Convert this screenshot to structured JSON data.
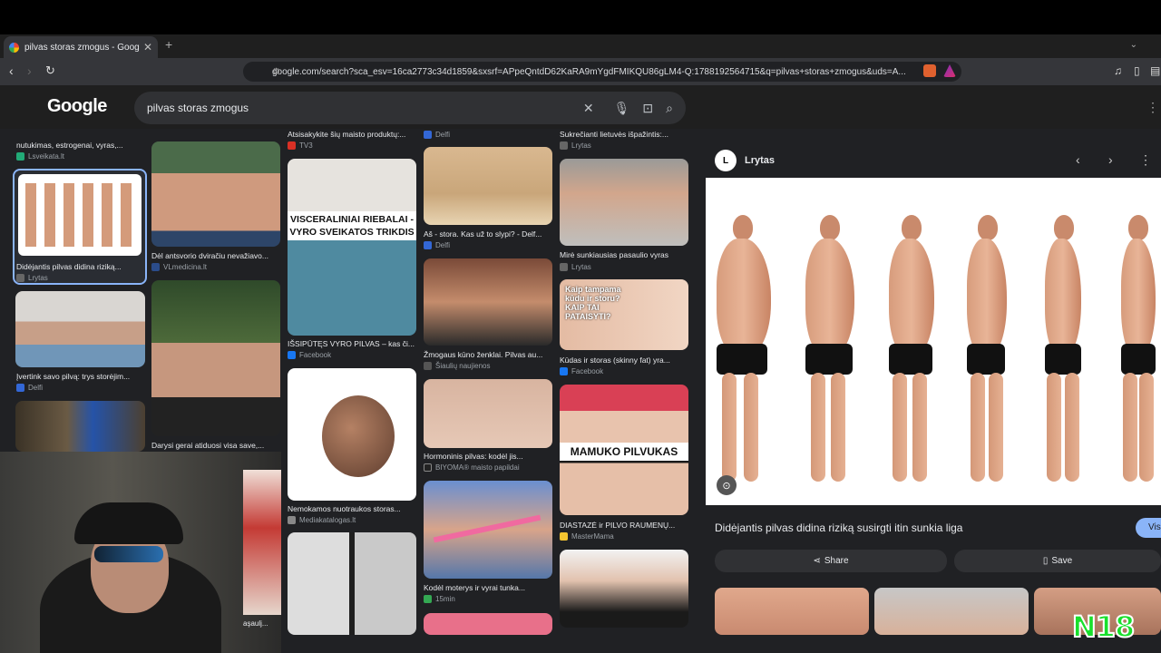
{
  "browser": {
    "tab_title": "pilvas storas zmogus - Google S",
    "url": "google.com/search?sca_esv=16ca2773c34d1859&sxsrf=APpeQntdD62KaRA9mYgdFMIKQU86gLM4-Q:1788192564715&q=pilvas+storas+zmogus&uds=A..."
  },
  "google": {
    "logo": "Google",
    "query": "pilvas storas zmogus"
  },
  "results": {
    "c1": [
      {
        "cap": "nutukimas, estrogenai, vyras,...",
        "src": "Lsveikata.lt"
      },
      {
        "cap": "Didėjantis pilvas didina riziką...",
        "src": "Lrytas"
      },
      {
        "cap": "Įvertink savo pilvą: trys storėjim...",
        "src": "Delfi"
      }
    ],
    "c2": [
      {
        "cap": "Dėl antsvorio dviračiu nevažiavo...",
        "src": "VLmedicina.lt"
      },
      {
        "cap": "Darysi gerai atiduosi visa save,...",
        "src": ""
      }
    ],
    "c3": [
      {
        "cap": "Atsisakykite šių maisto produktų:...",
        "src": "TV3"
      },
      {
        "cap": "IŠSIPŪTĘS VYRO PILVAS – kas či...",
        "src": "Facebook",
        "overlay": "VISCERALINIAI RIEBALAI - VYRO SVEIKATOS TRIKDIS"
      },
      {
        "cap": "Nemokamos nuotraukos storas...",
        "src": "Mediakatalogas.lt"
      }
    ],
    "c4": [
      {
        "cap": "",
        "src": "Delfi"
      },
      {
        "cap": "Aš - stora. Kas už to slypi? - Delf...",
        "src": "Delfi"
      },
      {
        "cap": "Žmogaus kūno ženklai. Pilvas au...",
        "src": "Šiaulių naujienos"
      },
      {
        "cap": "Hormoninis pilvas: kodėl jis...",
        "src": "BIYOMA® maisto papildai"
      },
      {
        "cap": "Kodėl moterys ir vyrai tunka...",
        "src": "15min"
      }
    ],
    "c5": [
      {
        "cap": "Sukrečianti lietuvės išpažintis:...",
        "src": "Lrytas"
      },
      {
        "cap": "Mirė sunkiausias pasaulio vyras",
        "src": "Lrytas"
      },
      {
        "cap": "Kūdas ir storas (skinny fat) yra...",
        "src": "Facebook",
        "overlay": "Kaip tampama kūdu ir storu? KAIP TAI PATAISYTI?"
      },
      {
        "cap": "DIASTAZĖ ir PILVO RAUMENŲ...",
        "src": "MasterMama",
        "overlay": "MAMUKO PILVUKAS"
      }
    ]
  },
  "panel": {
    "source": "Lrytas",
    "title": "Didėjantis pilvas didina riziką susirgti itin sunkia liga",
    "visit": "Vis",
    "share": "Share",
    "save": "Save"
  },
  "webcam": {
    "label": "aşaulj..."
  },
  "watermark": "N18",
  "colors": {
    "bg": "#202124",
    "search": "#303134",
    "accent_green": "#18e02c"
  }
}
